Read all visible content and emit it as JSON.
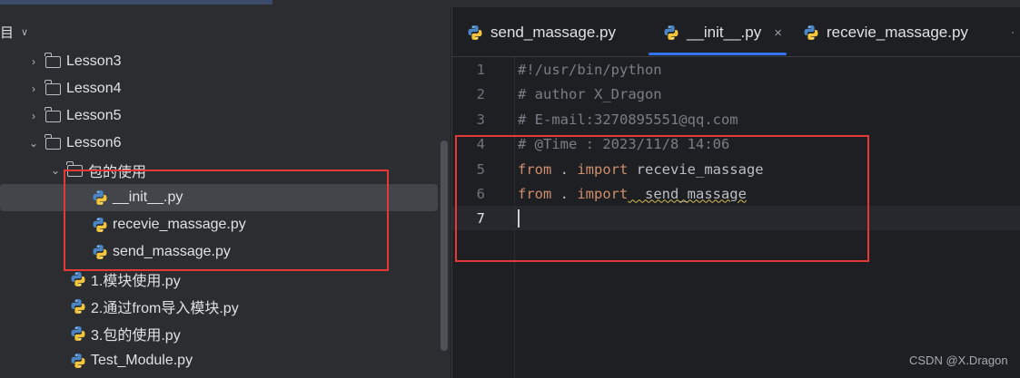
{
  "project_panel": {
    "header_label": "目",
    "tree": [
      {
        "label": "Lesson3",
        "kind": "folder",
        "expanded": false
      },
      {
        "label": "Lesson4",
        "kind": "folder",
        "expanded": false
      },
      {
        "label": "Lesson5",
        "kind": "folder",
        "expanded": false
      },
      {
        "label": "Lesson6",
        "kind": "folder",
        "expanded": true
      },
      {
        "label": "包的使用",
        "kind": "package",
        "expanded": true
      },
      {
        "label": "__init__.py",
        "kind": "python-file",
        "selected": true
      },
      {
        "label": "recevie_massage.py",
        "kind": "python-file"
      },
      {
        "label": "send_massage.py",
        "kind": "python-file"
      },
      {
        "label": "1.模块使用.py",
        "kind": "python-file"
      },
      {
        "label": "2.通过from导入模块.py",
        "kind": "python-file"
      },
      {
        "label": "3.包的使用.py",
        "kind": "python-file"
      },
      {
        "label": "Test_Module.py",
        "kind": "python-file"
      }
    ]
  },
  "editor": {
    "tabs": [
      {
        "label": "send_massage.py",
        "active": false
      },
      {
        "label": "__init__.py",
        "active": true,
        "close_glyph": "×"
      },
      {
        "label": "recevie_massage.py",
        "active": false
      }
    ],
    "lines": [
      {
        "number": "1",
        "text": "#!/usr/bin/python"
      },
      {
        "number": "2",
        "text": "# author X_Dragon"
      },
      {
        "number": "3",
        "text": "# E-mail:3270895551@qq.com"
      },
      {
        "number": "4",
        "text": "# @Time : 2023/11/8 14:06"
      },
      {
        "number": "5",
        "keyword_from": "from",
        "middle": " . ",
        "keyword_import": "import",
        "module": " recevie_massage"
      },
      {
        "number": "6",
        "keyword_from": "from",
        "middle": " . ",
        "keyword_import": "import",
        "module": "  send_massage"
      },
      {
        "number": "7",
        "text": ""
      }
    ]
  },
  "watermark": "CSDN @X.Dragon",
  "colors": {
    "panel_bg": "#2b2d30",
    "editor_bg": "#1e1f22",
    "keyword": "#cf8e6d",
    "comment": "#7a7e85",
    "accent": "#3574f0",
    "annotation_red": "#e53935"
  }
}
